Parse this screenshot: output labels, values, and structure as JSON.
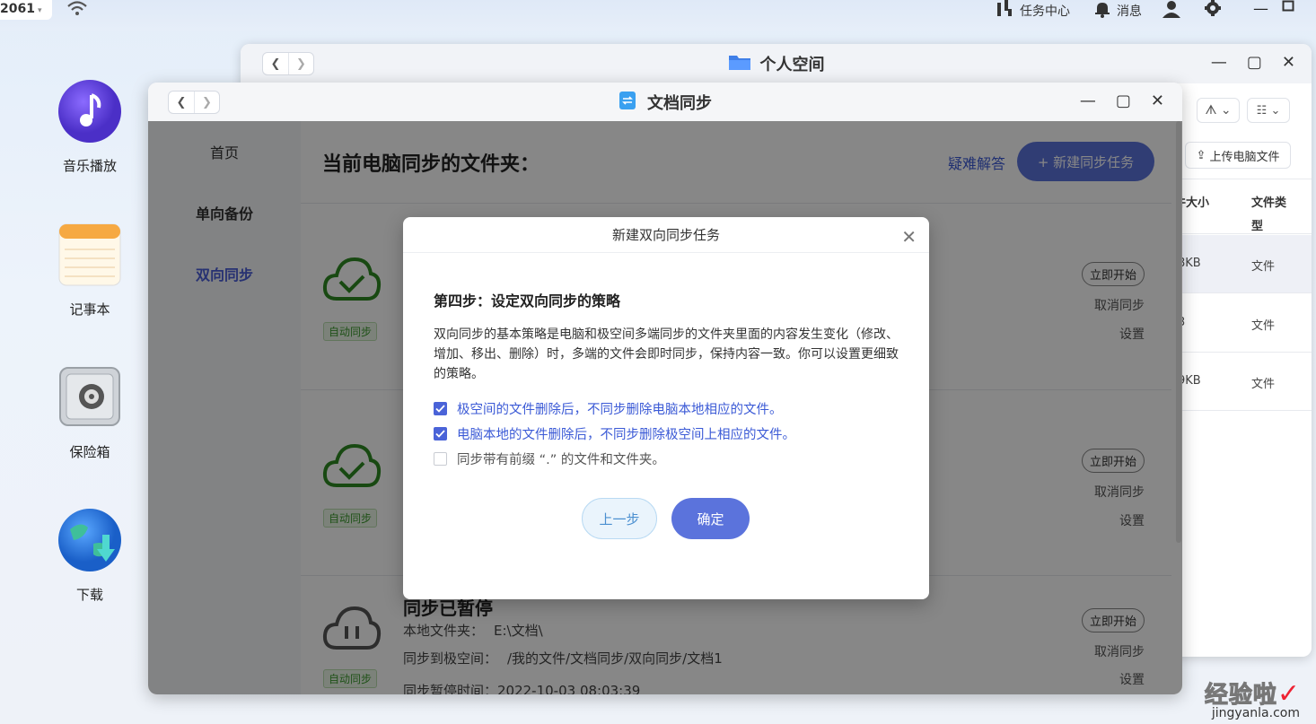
{
  "topbar": {
    "net_label": "2061",
    "tasks": "任务中心",
    "messages": "消息"
  },
  "desktop": {
    "items": [
      {
        "label": "音乐播放"
      },
      {
        "label": "记事本"
      },
      {
        "label": "保险箱"
      },
      {
        "label": "下载"
      }
    ]
  },
  "personal_window": {
    "title": "个人空间",
    "upload_btn": "上传电脑文件",
    "columns": [
      "件大小",
      "文件类型"
    ],
    "rows": [
      {
        "size": "8KB",
        "type": "文件"
      },
      {
        "size": "3",
        "type": "文件"
      },
      {
        "size": "9KB",
        "type": "文件"
      }
    ]
  },
  "sync_window": {
    "title": "文档同步",
    "sidebar": [
      "首页",
      "单向备份",
      "双向同步"
    ],
    "active_index": 2,
    "heading": "当前电脑同步的文件夹：",
    "help_link": "疑难解答",
    "new_task_btn": "+ 新建同步任务",
    "cards": [
      {
        "tag": "自动同步",
        "start": "立即开始",
        "cancel": "取消同步",
        "settings": "设置"
      },
      {
        "tag": "自动同步",
        "start": "立即开始",
        "cancel": "取消同步",
        "settings": "设置"
      },
      {
        "status": "同步已暂停",
        "local_label": "本地文件夹：",
        "local_path": "E:\\文档\\",
        "remote_label": "同步到极空间：",
        "remote_path": "/我的文件/文档同步/双向同步/文档1",
        "paused_time": "同步暂停时间：2022-10-03 08:03:39",
        "tag": "自动同步",
        "start": "立即开始",
        "cancel": "取消同步",
        "settings": "设置"
      }
    ]
  },
  "dialog": {
    "title": "新建双向同步任务",
    "step": "第四步：设定双向同步的策略",
    "description": "双向同步的基本策略是电脑和极空间多端同步的文件夹里面的内容发生变化（修改、增加、移出、删除）时，多端的文件会即时同步，保持内容一致。你可以设置更细致的策略。",
    "options": [
      {
        "label": "极空间的文件删除后，不同步删除电脑本地相应的文件。",
        "checked": true
      },
      {
        "label": "电脑本地的文件删除后，不同步删除极空间上相应的文件。",
        "checked": true
      },
      {
        "label": "同步带有前缀 “.” 的文件和文件夹。",
        "checked": false
      }
    ],
    "prev_btn": "上一步",
    "ok_btn": "确定"
  },
  "watermark": {
    "zh": "经验啦",
    "en": "jingyanla.com"
  },
  "colors": {
    "accent": "#5b73dc",
    "link": "#3b5ad6",
    "auto_tag": "#3c9a2e"
  }
}
